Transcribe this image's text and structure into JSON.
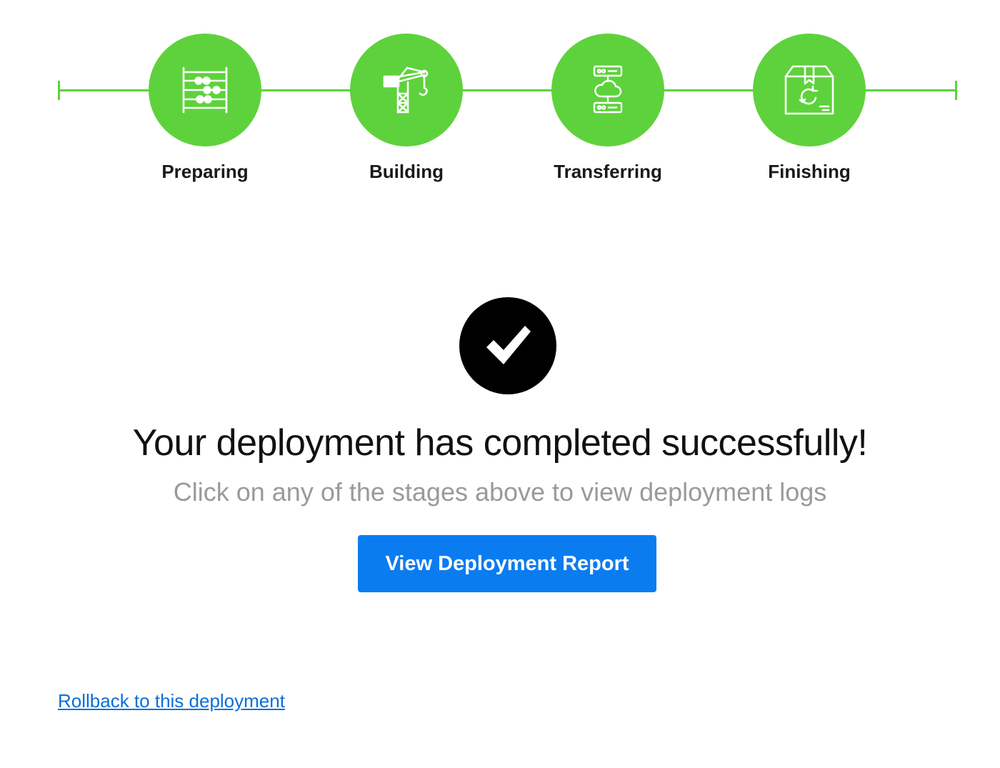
{
  "stages": [
    {
      "label": "Preparing",
      "icon": "abacus-icon"
    },
    {
      "label": "Building",
      "icon": "crane-icon"
    },
    {
      "label": "Transferring",
      "icon": "server-cloud-icon"
    },
    {
      "label": "Finishing",
      "icon": "package-refresh-icon"
    }
  ],
  "status": {
    "icon": "checkmark-icon",
    "headline": "Your deployment has completed successfully!",
    "subline": "Click on any of the stages above to view deployment logs"
  },
  "actions": {
    "report_button_label": "View Deployment Report",
    "rollback_link_label": "Rollback to this deployment"
  },
  "colors": {
    "stage_complete": "#5ed23c",
    "primary_button": "#0a7cf0",
    "link": "#0a6fd8",
    "muted_text": "#9a9a9a"
  }
}
